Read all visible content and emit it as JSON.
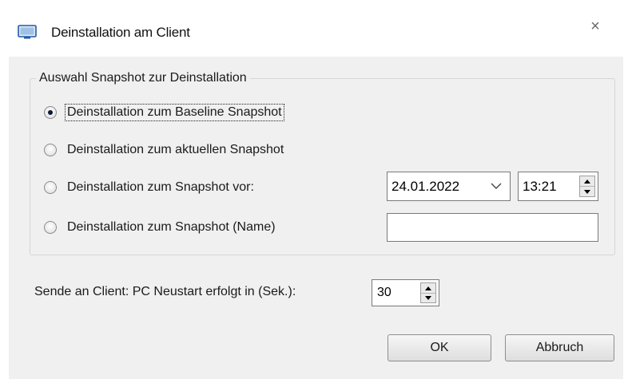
{
  "window": {
    "title": "Deinstallation am Client",
    "close_glyph": "×",
    "app_icon": "monitor-icon"
  },
  "group": {
    "legend": "Auswahl Snapshot zur Deinstallation",
    "options": [
      {
        "label": "Deinstallation zum Baseline Snapshot",
        "checked": true
      },
      {
        "label": "Deinstallation zum aktuellen Snapshot",
        "checked": false
      },
      {
        "label": "Deinstallation zum Snapshot vor:",
        "checked": false
      },
      {
        "label": "Deinstallation zum Snapshot (Name)",
        "checked": false
      }
    ],
    "date_value": "24.01.2022",
    "time_value": "13:21",
    "name_value": ""
  },
  "restart": {
    "label": "Sende an Client: PC Neustart erfolgt in (Sek.):",
    "value": "30"
  },
  "buttons": {
    "ok": "OK",
    "cancel": "Abbruch"
  },
  "colors": {
    "client_bg": "#f0f0f0",
    "border": "#7a7a7a",
    "icon_blue": "#1e5aa8"
  }
}
